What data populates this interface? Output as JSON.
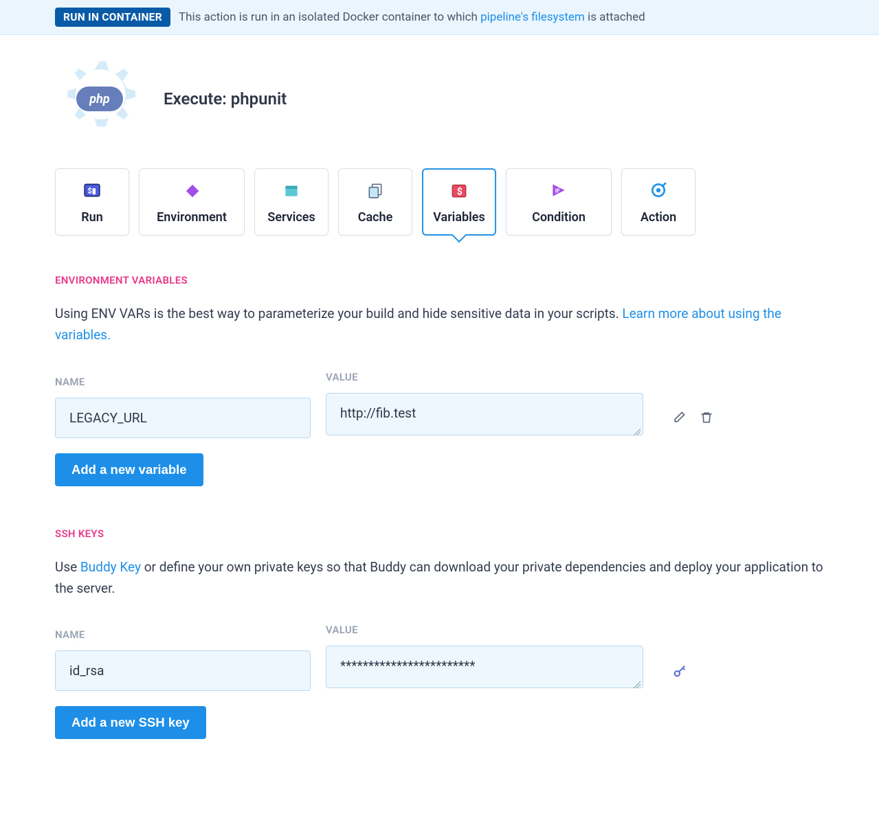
{
  "banner": {
    "badge": "RUN IN CONTAINER",
    "text_before": "This action is run in an isolated Docker container to which ",
    "link": "pipeline's filesystem",
    "text_after": " is attached"
  },
  "header": {
    "title": "Execute: phpunit",
    "logo_text": "php"
  },
  "tabs": [
    {
      "label": "Run"
    },
    {
      "label": "Environment"
    },
    {
      "label": "Services"
    },
    {
      "label": "Cache"
    },
    {
      "label": "Variables"
    },
    {
      "label": "Condition"
    },
    {
      "label": "Action"
    }
  ],
  "env_section": {
    "title": "ENVIRONMENT VARIABLES",
    "description_before": "Using ENV VARs is the best way to parameterize your build and hide sensitive data in your scripts. ",
    "link": "Learn more about using the variables.",
    "name_label": "NAME",
    "value_label": "VALUE",
    "rows": [
      {
        "name": "LEGACY_URL",
        "value": "http://fib.test"
      }
    ],
    "button": "Add a new variable"
  },
  "ssh_section": {
    "title": "SSH KEYS",
    "desc_before": "Use ",
    "desc_link": "Buddy Key",
    "desc_after": " or define your own private keys so that Buddy can download your private dependencies and deploy your application to the server.",
    "name_label": "NAME",
    "value_label": "VALUE",
    "rows": [
      {
        "name": "id_rsa",
        "value": "************************"
      }
    ],
    "button": "Add a new SSH key"
  }
}
